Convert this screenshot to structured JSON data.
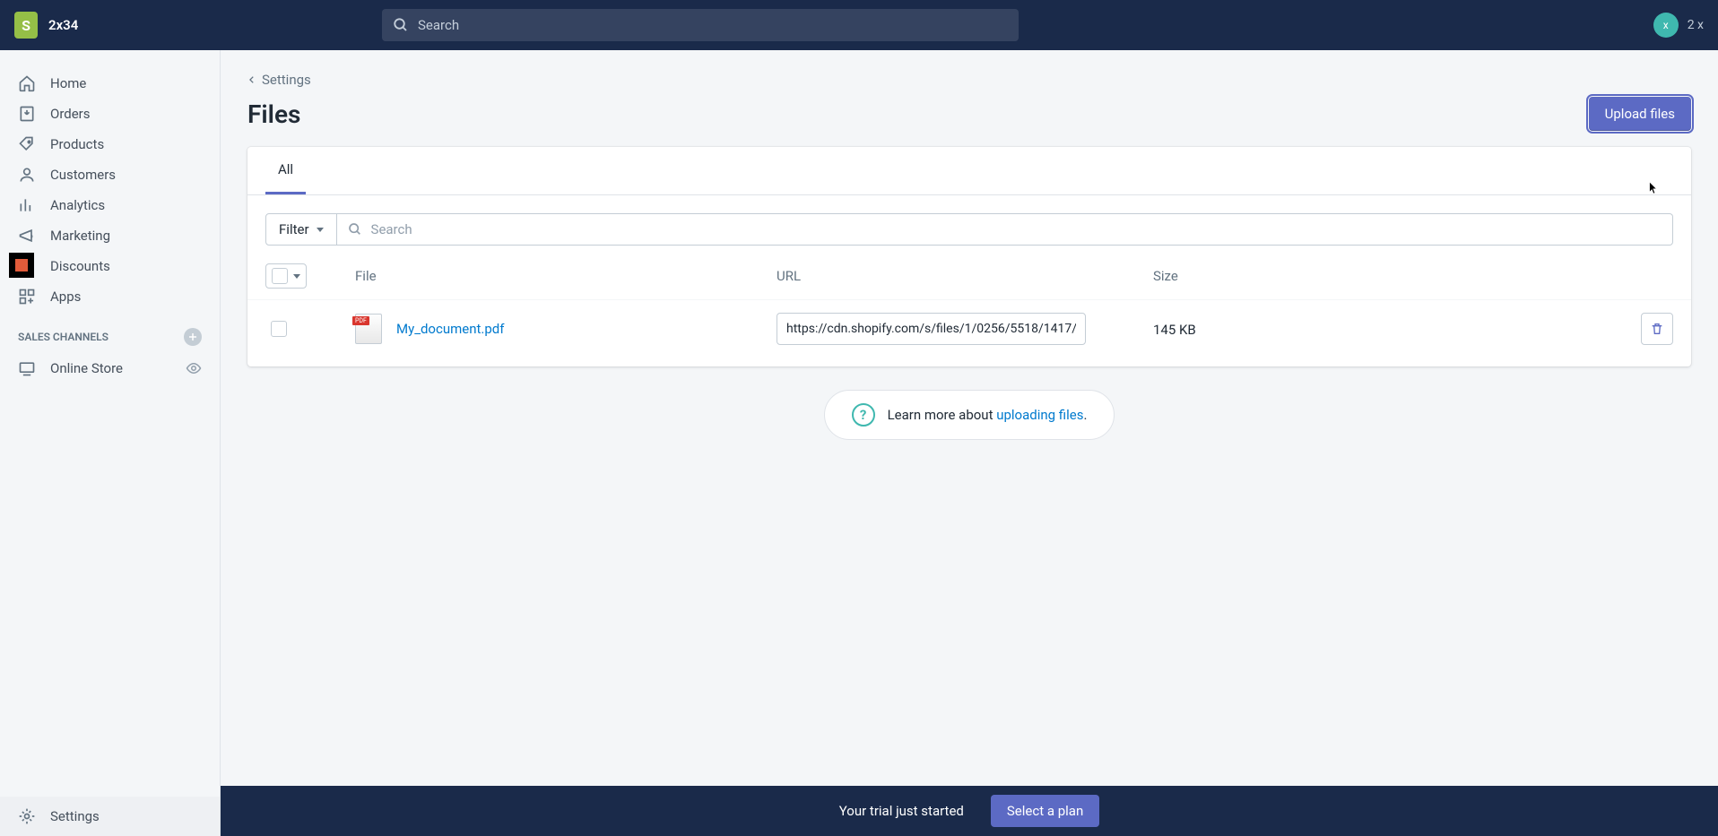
{
  "topbar": {
    "store_name": "2x34",
    "search_placeholder": "Search",
    "avatar_initial": "x",
    "user_label": "2 x"
  },
  "sidebar": {
    "items": [
      {
        "label": "Home"
      },
      {
        "label": "Orders"
      },
      {
        "label": "Products"
      },
      {
        "label": "Customers"
      },
      {
        "label": "Analytics"
      },
      {
        "label": "Marketing"
      },
      {
        "label": "Discounts"
      },
      {
        "label": "Apps"
      }
    ],
    "section_label": "SALES CHANNELS",
    "online_store": "Online Store",
    "settings": "Settings"
  },
  "main": {
    "breadcrumb": "Settings",
    "title": "Files",
    "upload_button": "Upload files",
    "tab_all": "All",
    "filter_label": "Filter",
    "filter_search_placeholder": "Search",
    "columns": {
      "file": "File",
      "url": "URL",
      "size": "Size"
    },
    "rows": [
      {
        "name": "My_document.pdf",
        "url": "https://cdn.shopify.com/s/files/1/0256/5518/1417/",
        "size": "145 KB"
      }
    ],
    "help_prefix": "Learn more about ",
    "help_link": "uploading files",
    "help_suffix": "."
  },
  "bottom": {
    "trial_text": "Your trial just started",
    "select_plan": "Select a plan"
  }
}
